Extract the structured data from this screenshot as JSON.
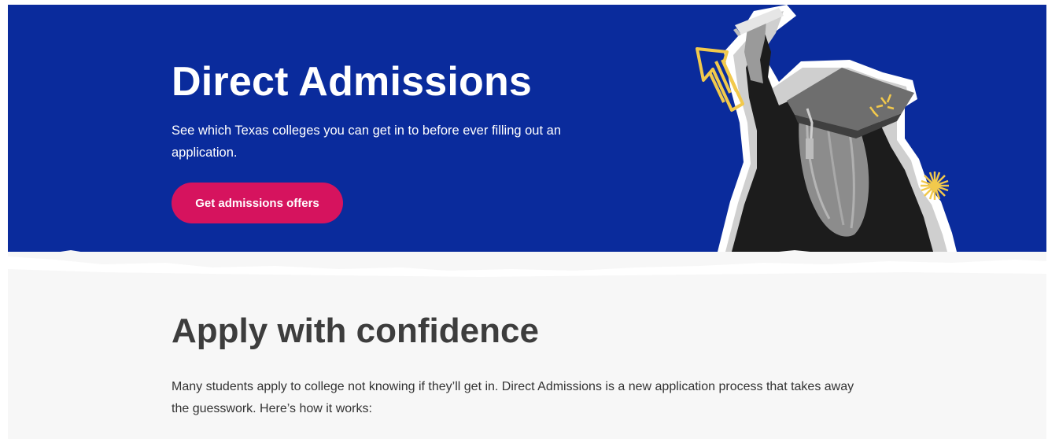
{
  "hero": {
    "title": "Direct Admissions",
    "subtitle": "See which Texas colleges you can get in to before ever filling out an application.",
    "cta_label": "Get admissions offers",
    "background_color": "#0a2b9c",
    "cta_color": "#d6135e",
    "illustration": "graduate-with-diploma-image",
    "accent_color": "#f2c94c"
  },
  "section": {
    "title": "Apply with confidence",
    "body": "Many students apply to college not knowing if they’ll get in. Direct Admissions is a new application process that takes away the guesswork. Here’s how it works:",
    "background_color": "#f7f7f7"
  }
}
